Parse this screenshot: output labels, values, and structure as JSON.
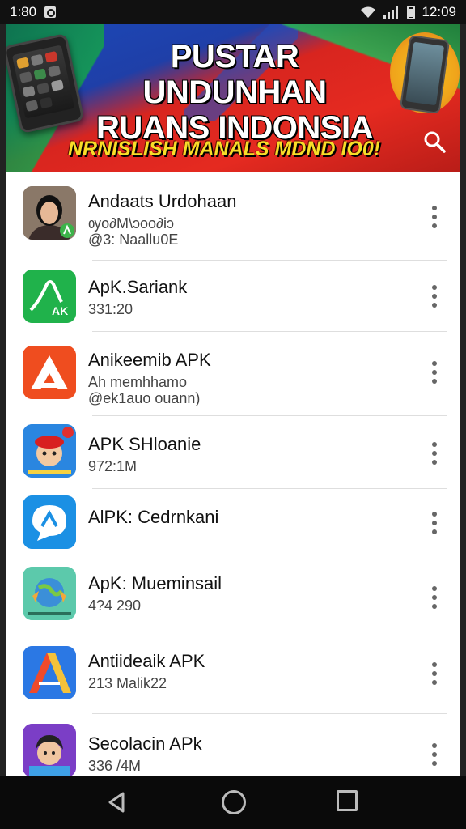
{
  "status_bar": {
    "time_left": "1:80",
    "time_right": "12:09"
  },
  "banner": {
    "title_line1": "PUSTAR UNDUNHAN",
    "title_line2": "RUANS INDONSIA",
    "subtitle": "NRNISLISH MANALS MDND IO0!"
  },
  "apps": [
    {
      "name": "Andaats Urdohaan",
      "meta1": "ѹo∂M\\ↄoo∂iↄ",
      "meta2": "@3: Naallu0E",
      "icon": "person-photo-icon",
      "accent": "#4caf50"
    },
    {
      "name": "ApK.Sariank",
      "meta1": "331:20",
      "meta2": "",
      "icon": "apk-green-icon",
      "accent": "#1fb24a"
    },
    {
      "name": "Anikeemib APK",
      "meta1": "Ah memhhamo",
      "meta2": "@ek1auo ouann)",
      "icon": "apk-orange-triangle-icon",
      "accent": "#f0501e"
    },
    {
      "name": "APK SHloanie",
      "meta1": "972:1M",
      "meta2": "",
      "icon": "avatar-red-hat-icon",
      "accent": "#1f7bd6"
    },
    {
      "name": "AlPK: Cedrnkani",
      "meta1": "",
      "meta2": "",
      "icon": "chat-bubble-icon",
      "accent": "#1a8fe3"
    },
    {
      "name": "ApK: Mueminsail",
      "meta1": "4?4 290",
      "meta2": "",
      "icon": "globe-creature-icon",
      "accent": "#4cc2a3"
    },
    {
      "name": "Antiideaik APK",
      "meta1": "213 Malik22",
      "meta2": "",
      "icon": "apk-blue-triangle-icon",
      "accent": "#2a6fe0"
    },
    {
      "name": "Secolacin APk",
      "meta1": "336 /4M",
      "meta2": "",
      "icon": "avatar-boy-icon",
      "accent": "#7a3cc4"
    }
  ]
}
